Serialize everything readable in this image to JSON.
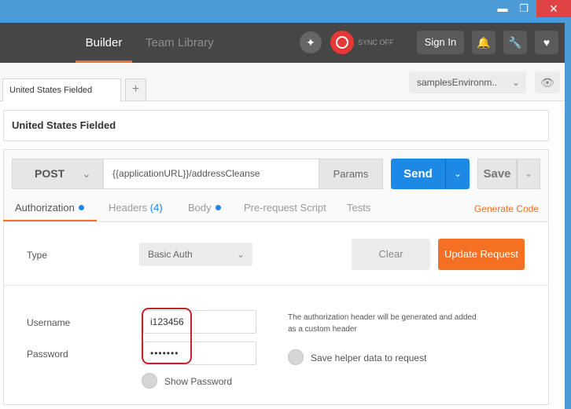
{
  "window": {
    "minimize_icon": "minimize-icon",
    "maximize_icon": "maximize-icon",
    "close_icon": "close-icon",
    "minimize_glyph": "▬",
    "maximize_glyph": "❐",
    "close_glyph": "✕"
  },
  "header": {
    "tabs": [
      "Builder",
      "Team Library"
    ],
    "active_tab": "Builder",
    "sync_label": "SYNC OFF",
    "signin_label": "Sign In",
    "icons": [
      "interceptor-icon",
      "sync-icon",
      "bell-icon",
      "wrench-icon",
      "heart-icon"
    ],
    "bell_glyph": "🔔",
    "wrench_glyph": "🔧",
    "heart_glyph": "♥",
    "interceptor_glyph": "✦"
  },
  "tabstrip": {
    "request_tab_label": "United States Fielded",
    "add_glyph": "+",
    "environment": "samplesEnvironm..",
    "chevron_glyph": "⌄",
    "eye_glyph": "👁"
  },
  "request": {
    "name": "United States Fielded",
    "method": "POST",
    "url": "{{applicationURL}}/addressCleanse",
    "params_label": "Params",
    "send_label": "Send",
    "save_label": "Save"
  },
  "subtabs": {
    "authorization": "Authorization",
    "headers": "Headers",
    "headers_count": "(4)",
    "body": "Body",
    "prerequest": "Pre-request Script",
    "tests": "Tests",
    "generate_code": "Generate Code"
  },
  "auth": {
    "type_label": "Type",
    "type_value": "Basic Auth",
    "clear_label": "Clear",
    "update_label": "Update Request",
    "username_label": "Username",
    "username_value": "i123456",
    "password_label": "Password",
    "password_value": "•••••••",
    "note": "The authorization header will be generated and added as a custom header",
    "save_helper_label": "Save helper data to request",
    "show_password_label": "Show Password"
  },
  "colors": {
    "accent": "#f47023",
    "primary": "#1e88e5",
    "header_bg": "#464646",
    "highlight": "#c0252e"
  }
}
